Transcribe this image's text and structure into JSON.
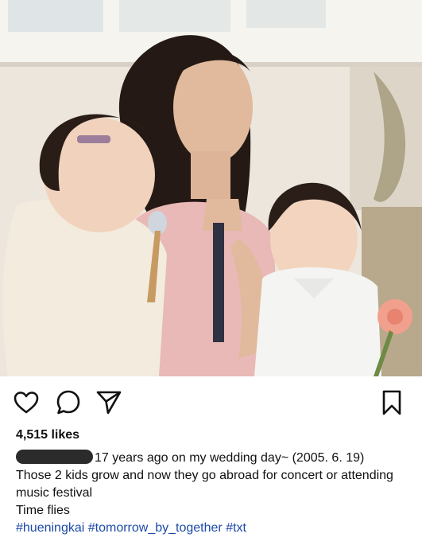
{
  "post": {
    "likes": "4,515 likes",
    "caption_line1": "17 years ago on my wedding day~ (2005. 6. 19)",
    "caption_line2": "Those 2 kids grow and now they go abroad for concert or attending music festival",
    "caption_line3": "Time flies",
    "hashtag_1": "#hueningkai",
    "hashtag_2": "#tomorrow_by_together",
    "hashtag_3": "#txt"
  },
  "icons": {
    "like": "heart-icon",
    "comment": "comment-bubble-icon",
    "share": "paper-plane-icon",
    "save": "bookmark-icon"
  },
  "colors": {
    "hashtag": "#1c4aa8",
    "redaction": "#2b2b2b"
  }
}
